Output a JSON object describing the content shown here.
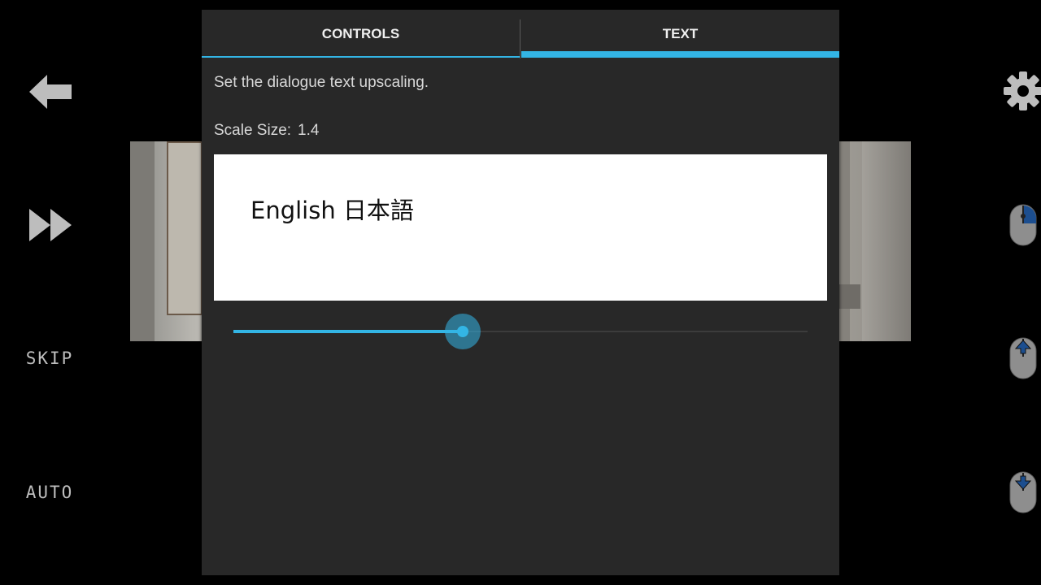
{
  "dialog": {
    "tabs": [
      {
        "label": "CONTROLS",
        "selected": false
      },
      {
        "label": "TEXT",
        "selected": true
      }
    ],
    "description": "Set the dialogue text upscaling.",
    "scale_label": "Scale Size:",
    "scale_value": "1.4",
    "preview_text": "English 日本語",
    "slider_fraction": 0.4
  },
  "side_left": {
    "back_icon": "back-arrow-icon",
    "fast_forward_icon": "fast-forward-icon",
    "skip_label": "SKIP",
    "auto_label": "AUTO"
  },
  "side_right": {
    "settings_icon": "gear-icon",
    "right_click_icon": "mouse-right-click-icon",
    "scroll_up_icon": "mouse-scroll-up-icon",
    "scroll_down_icon": "mouse-scroll-down-icon"
  },
  "colors": {
    "accent": "#33b5e5",
    "dialog_bg": "#282828",
    "text": "#d8d8d8",
    "side_icon": "#bdbdbd"
  }
}
